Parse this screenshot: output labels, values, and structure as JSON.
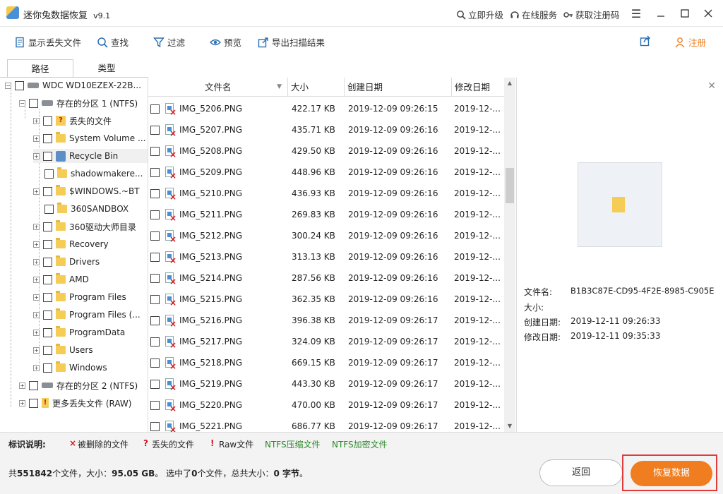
{
  "title": {
    "name": "迷你兔数据恢复",
    "version": "v9.1"
  },
  "titlebar_links": {
    "upgrade": "立即升级",
    "online": "在线服务",
    "register_code": "获取注册码"
  },
  "toolbar": {
    "show_lost": "显示丢失文件",
    "find": "查找",
    "filter": "过滤",
    "preview": "预览",
    "export": "导出扫描结果",
    "register": "注册"
  },
  "tabs": {
    "path": "路径",
    "type": "类型"
  },
  "tree": {
    "disk": "WDC WD10EZEX-22B...",
    "partition1": "存在的分区 1 (NTFS)",
    "items": [
      "丢失的文件",
      "System Volume ...",
      "Recycle Bin",
      "shadowmakere...",
      "$WINDOWS.~BT",
      "360SANDBOX",
      "360驱动大师目录",
      "Recovery",
      "Drivers",
      "AMD",
      "Program Files",
      "Program Files (...",
      "ProgramData",
      "Users",
      "Windows"
    ],
    "partition2": "存在的分区 2 (NTFS)",
    "raw": "更多丢失文件 (RAW)"
  },
  "file_table": {
    "headers": {
      "name": "文件名",
      "size": "大小",
      "created": "创建日期",
      "modified": "修改日期"
    },
    "rows": [
      {
        "name": "IMG_5206.PNG",
        "size": "422.17 KB",
        "created": "2019-12-09 09:26:15",
        "modified": "2019-12-..."
      },
      {
        "name": "IMG_5207.PNG",
        "size": "435.71 KB",
        "created": "2019-12-09 09:26:16",
        "modified": "2019-12-..."
      },
      {
        "name": "IMG_5208.PNG",
        "size": "429.50 KB",
        "created": "2019-12-09 09:26:16",
        "modified": "2019-12-..."
      },
      {
        "name": "IMG_5209.PNG",
        "size": "448.96 KB",
        "created": "2019-12-09 09:26:16",
        "modified": "2019-12-..."
      },
      {
        "name": "IMG_5210.PNG",
        "size": "436.93 KB",
        "created": "2019-12-09 09:26:16",
        "modified": "2019-12-..."
      },
      {
        "name": "IMG_5211.PNG",
        "size": "269.83 KB",
        "created": "2019-12-09 09:26:16",
        "modified": "2019-12-..."
      },
      {
        "name": "IMG_5212.PNG",
        "size": "300.24 KB",
        "created": "2019-12-09 09:26:16",
        "modified": "2019-12-..."
      },
      {
        "name": "IMG_5213.PNG",
        "size": "313.13 KB",
        "created": "2019-12-09 09:26:16",
        "modified": "2019-12-..."
      },
      {
        "name": "IMG_5214.PNG",
        "size": "287.56 KB",
        "created": "2019-12-09 09:26:16",
        "modified": "2019-12-..."
      },
      {
        "name": "IMG_5215.PNG",
        "size": "362.35 KB",
        "created": "2019-12-09 09:26:16",
        "modified": "2019-12-..."
      },
      {
        "name": "IMG_5216.PNG",
        "size": "396.38 KB",
        "created": "2019-12-09 09:26:17",
        "modified": "2019-12-..."
      },
      {
        "name": "IMG_5217.PNG",
        "size": "324.09 KB",
        "created": "2019-12-09 09:26:17",
        "modified": "2019-12-..."
      },
      {
        "name": "IMG_5218.PNG",
        "size": "669.15 KB",
        "created": "2019-12-09 09:26:17",
        "modified": "2019-12-..."
      },
      {
        "name": "IMG_5219.PNG",
        "size": "443.30 KB",
        "created": "2019-12-09 09:26:17",
        "modified": "2019-12-..."
      },
      {
        "name": "IMG_5220.PNG",
        "size": "470.00 KB",
        "created": "2019-12-09 09:26:17",
        "modified": "2019-12-..."
      },
      {
        "name": "IMG_5221.PNG",
        "size": "686.77 KB",
        "created": "2019-12-09 09:26:17",
        "modified": "2019-12-..."
      }
    ]
  },
  "preview": {
    "name_label": "文件名:",
    "name_value": "B1B3C87E-CD95-4F2E-8985-C905E",
    "size_label": "大小:",
    "created_label": "创建日期:",
    "created_value": "2019-12-11 09:26:33",
    "modified_label": "修改日期:",
    "modified_value": "2019-12-11 09:35:33"
  },
  "legend": {
    "title": "标识说明:",
    "deleted": "被删除的文件",
    "lost": "丢失的文件",
    "raw": "Raw文件",
    "compressed": "NTFS压缩文件",
    "encrypted": "NTFS加密文件"
  },
  "status": {
    "p1": "共",
    "count": "551842",
    "p2": "个文件，大小：",
    "size": "95.05 GB",
    "p3": "。 选中了",
    "sel_count": "0",
    "p4": "个文件，总共大小：",
    "sel_size": "0 字节",
    "p5": "。"
  },
  "buttons": {
    "back": "返回",
    "recover": "恢复数据"
  },
  "colors": {
    "accent": "#f07d1f",
    "deleted_mark": "#d0161f",
    "ntfs_mark": "#2a8a2a",
    "highlight_box": "#e03c3c"
  }
}
